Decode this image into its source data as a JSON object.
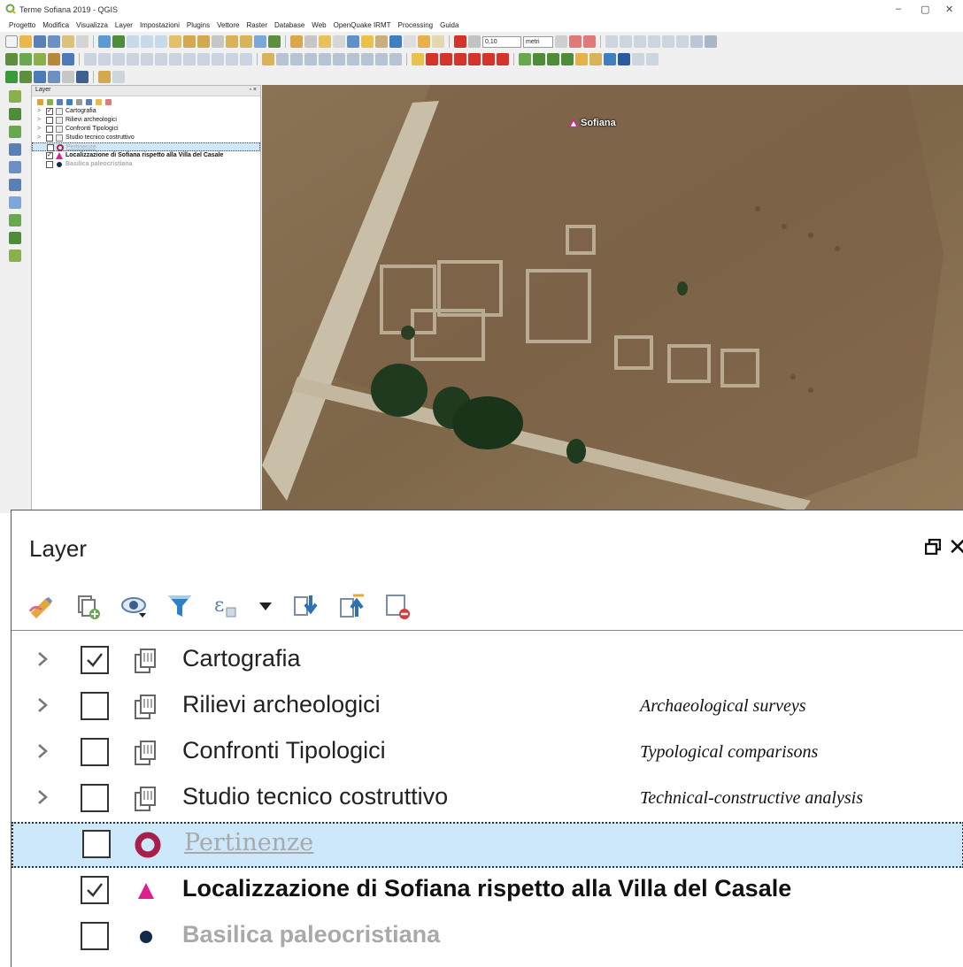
{
  "window": {
    "title": "Terme Sofiana 2019 - QGIS",
    "minimize": "–",
    "maximize": "▢",
    "close": "✕"
  },
  "menu": [
    "Progetto",
    "Modifica",
    "Visualizza",
    "Layer",
    "Impostazioni",
    "Plugins",
    "Vettore",
    "Raster",
    "Database",
    "Web",
    "OpenQuake IRMT",
    "Processing",
    "Guida"
  ],
  "toolbar": {
    "scale_value": "0,10",
    "unit_value": "metri"
  },
  "small_panel": {
    "title": "Layer",
    "controls": "▫ ×",
    "rows": [
      {
        "label": "Cartografia",
        "checked": "✓",
        "expand": ">"
      },
      {
        "label": "Rilievi archeologici",
        "checked": "",
        "expand": ">"
      },
      {
        "label": "Confronti Tipologici",
        "checked": "",
        "expand": ">"
      },
      {
        "label": "Studio tecnico costruttivo",
        "checked": "",
        "expand": ">"
      },
      {
        "label": "Pertinenze",
        "checked": "",
        "expand": ""
      },
      {
        "label": "Localizzazione di Sofiana rispetto alla Villa del Casale",
        "checked": "✓",
        "expand": ""
      },
      {
        "label": "Basilica paleocristiana",
        "checked": "",
        "expand": ""
      }
    ]
  },
  "map": {
    "point_label": "Sofiana"
  },
  "zoom_panel": {
    "title": "Layer",
    "close": "✕",
    "rows": [
      {
        "label": "Cartografia",
        "note": ""
      },
      {
        "label": "Rilievi archeologici",
        "note": "Archaeological surveys"
      },
      {
        "label": "Confronti Tipologici",
        "note": "Typological comparisons"
      },
      {
        "label": "Studio tecnico costruttivo",
        "note": "Technical-constructive analysis"
      },
      {
        "label": "Pertinenze",
        "note": ""
      },
      {
        "label": "Localizzazione di Sofiana rispetto alla Villa del Casale",
        "note": ""
      },
      {
        "label": "Basilica paleocristiana",
        "note": ""
      }
    ]
  },
  "colors": {
    "selection": "#cde8fa",
    "pertinenze_symbol": "#a8204a",
    "localizzazione_symbol": "#e0208a",
    "basilica_symbol": "#12294a"
  }
}
